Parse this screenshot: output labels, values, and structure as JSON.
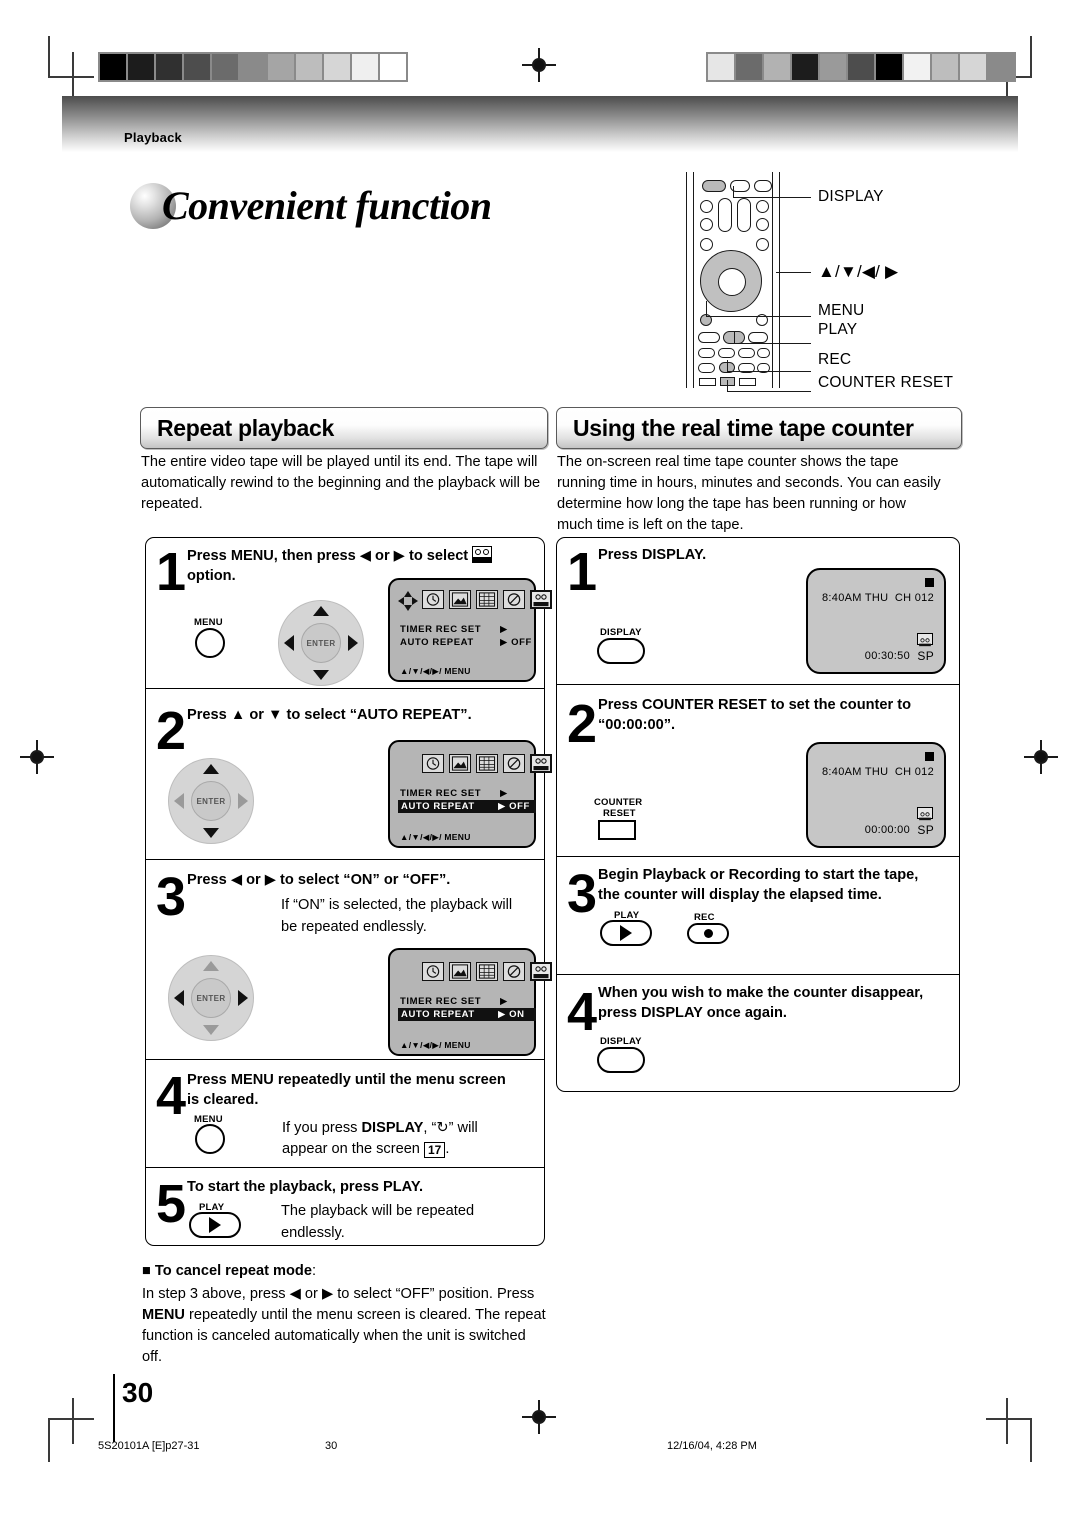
{
  "print_marks": {
    "gray_bar_left": [
      "#000000",
      "#1c1c1c",
      "#303030",
      "#4d4d4d",
      "#6b6b6b",
      "#8a8a8a",
      "#a5a5a5",
      "#bdbdbd",
      "#d6d6d6",
      "#efefef",
      "#ffffff"
    ],
    "gray_bar_right": [
      "#e6e6e6",
      "#6b6b6b",
      "#b2b2b2",
      "#1c1c1c",
      "#9a9a9a",
      "#4d4d4d",
      "#000000",
      "#f2f2f2",
      "#bdbdbd",
      "#d6d6d6",
      "#8a8a8a"
    ]
  },
  "header": {
    "section_label": "Playback"
  },
  "title": {
    "text": "Convenient function"
  },
  "remote_callouts": [
    {
      "label": "DISPLAY"
    },
    {
      "label": "▲/▼/◀/ ▶"
    },
    {
      "label": "MENU"
    },
    {
      "label": "PLAY"
    },
    {
      "label": "REC"
    },
    {
      "label": "COUNTER RESET"
    }
  ],
  "left_column": {
    "heading": "Repeat playback",
    "intro": "The entire video tape will be played until its end. The tape will automatically rewind to the beginning and the playback will be repeated.",
    "steps": [
      {
        "num": "1",
        "head_a": "Press MENU, then press ◀ or ▶ to select",
        "head_b": "option.",
        "key_label": "MENU",
        "osd": {
          "row1_label": "TIMER  REC  SET",
          "row1_value": "▶",
          "row2_label": "AUTO  REPEAT",
          "row2_value": "▶ OFF",
          "footer": "▲/▼/◀/▶/ MENU",
          "highlight": "none",
          "show_cursor": true
        }
      },
      {
        "num": "2",
        "head_a": "Press ▲ or ▼ to select “AUTO REPEAT”.",
        "head_b": "",
        "osd": {
          "row1_label": "TIMER  REC  SET",
          "row1_value": "▶",
          "row2_label": "AUTO  REPEAT",
          "row2_value": "▶ OFF",
          "footer": "▲/▼/◀/▶/ MENU",
          "highlight": "row2",
          "show_cursor": false
        }
      },
      {
        "num": "3",
        "head_a": "Press ◀ or ▶ to select “ON” or “OFF”.",
        "head_b": "",
        "sub": "If “ON” is selected, the playback will be repeated endlessly.",
        "osd": {
          "row1_label": "TIMER  REC  SET",
          "row1_value": "▶",
          "row2_label": "AUTO  REPEAT",
          "row2_value": "▶ ON",
          "footer": "▲/▼/◀/▶/ MENU",
          "highlight": "row2",
          "show_cursor": false
        }
      },
      {
        "num": "4",
        "head_a": "Press MENU repeatedly until the menu screen",
        "head_b": "is cleared.",
        "key_label": "MENU",
        "note_a": "If you press ",
        "note_bold": "DISPLAY",
        "note_b": ", “↻” will",
        "note_c": "appear on the screen ",
        "note_pageref": "17",
        "note_d": "."
      },
      {
        "num": "5",
        "head_a": "To start the playback, press PLAY.",
        "head_b": "",
        "key_label": "PLAY",
        "sub": "The playback will be repeated endlessly."
      }
    ],
    "cancel": {
      "bullet": "■",
      "title": "To cancel repeat mode",
      "colon": ":",
      "body_1": "In step 3 above, press ◀ or ▶ to select “OFF” position. Press",
      "body_2_bold": "MENU",
      "body_2": " repeatedly until the menu screen is cleared. The repeat",
      "body_3": "function is canceled automatically when the unit is switched",
      "body_4": "off."
    }
  },
  "right_column": {
    "heading": "Using the real time tape counter",
    "intro": "The on-screen real time tape counter shows the tape running time in hours, minutes and seconds. You can easily determine how long the tape has been running or how much time is left on the tape.",
    "steps": [
      {
        "num": "1",
        "head_a": "Press DISPLAY.",
        "head_b": "",
        "key_label": "DISPLAY",
        "tv": {
          "time": "8:40AM  THU",
          "channel": "CH 012",
          "counter": "00:30:50",
          "speed": "SP"
        }
      },
      {
        "num": "2",
        "head_a": "Press COUNTER RESET to set the counter to",
        "head_b": "“00:00:00”.",
        "key_label_1": "COUNTER",
        "key_label_2": "RESET",
        "tv": {
          "time": "8:40AM  THU",
          "channel": "CH 012",
          "counter": "00:00:00",
          "speed": "SP"
        }
      },
      {
        "num": "3",
        "head_a": "Begin Playback or Recording to start the tape,",
        "head_b": "the counter will display the elapsed time.",
        "key_label_1": "PLAY",
        "key_label_2": "REC"
      },
      {
        "num": "4",
        "head_a": "When you wish to make the counter disappear,",
        "head_b": "press DISPLAY once again.",
        "key_label": "DISPLAY"
      }
    ]
  },
  "footer": {
    "page_number": "30",
    "doc_code": "5S20101A [E]p27-31",
    "center_page": "30",
    "timestamp": "12/16/04, 4:28 PM"
  }
}
